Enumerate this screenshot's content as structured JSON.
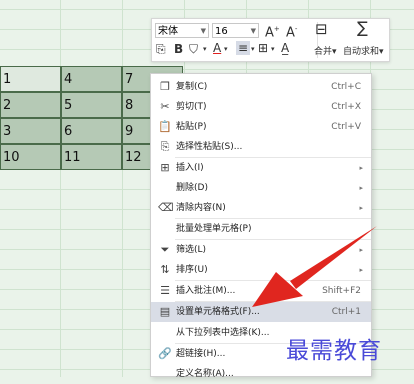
{
  "sheet": {
    "rows": [
      [
        "1",
        "4",
        "7"
      ],
      [
        "2",
        "5",
        "8"
      ],
      [
        "3",
        "6",
        "9"
      ],
      [
        "10",
        "11",
        "12"
      ]
    ]
  },
  "toolbar": {
    "font_name": "宋体",
    "font_size": "16",
    "increase_font": "A⁺",
    "decrease_font": "A⁻",
    "merge_label": "合并",
    "autosum_label": "自动求和"
  },
  "menu": {
    "items": [
      {
        "label": "复制(C)",
        "shortcut": "Ctrl+C",
        "icon": "copy-icon"
      },
      {
        "label": "剪切(T)",
        "shortcut": "Ctrl+X",
        "icon": "scissors-icon"
      },
      {
        "label": "粘贴(P)",
        "shortcut": "Ctrl+V",
        "icon": "paste-icon"
      },
      {
        "label": "选择性粘贴(S)...",
        "shortcut": "",
        "icon": "paste-special-icon"
      },
      {
        "label": "插入(I)",
        "shortcut": "",
        "icon": "insert-icon"
      },
      {
        "label": "删除(D)",
        "shortcut": "",
        "icon": ""
      },
      {
        "label": "清除内容(N)",
        "shortcut": "",
        "icon": "eraser-icon"
      },
      {
        "label": "批量处理单元格(P)",
        "shortcut": "",
        "icon": ""
      },
      {
        "label": "筛选(L)",
        "shortcut": "",
        "icon": "filter-icon"
      },
      {
        "label": "排序(U)",
        "shortcut": "",
        "icon": "sort-icon"
      },
      {
        "label": "插入批注(M)...",
        "shortcut": "Shift+F2",
        "icon": "comment-icon"
      },
      {
        "label": "设置单元格格式(F)...",
        "shortcut": "Ctrl+1",
        "icon": "format-cells-icon"
      },
      {
        "label": "从下拉列表中选择(K)...",
        "shortcut": "",
        "icon": ""
      },
      {
        "label": "超链接(H)...",
        "shortcut": "",
        "icon": "link-icon"
      },
      {
        "label": "定义名称(A)...",
        "shortcut": "",
        "icon": ""
      }
    ]
  },
  "watermark": "最需教育",
  "colors": {
    "arrow": "#e0261f",
    "highlight": "#d9dde6",
    "watermark": "#4a4ad8"
  }
}
